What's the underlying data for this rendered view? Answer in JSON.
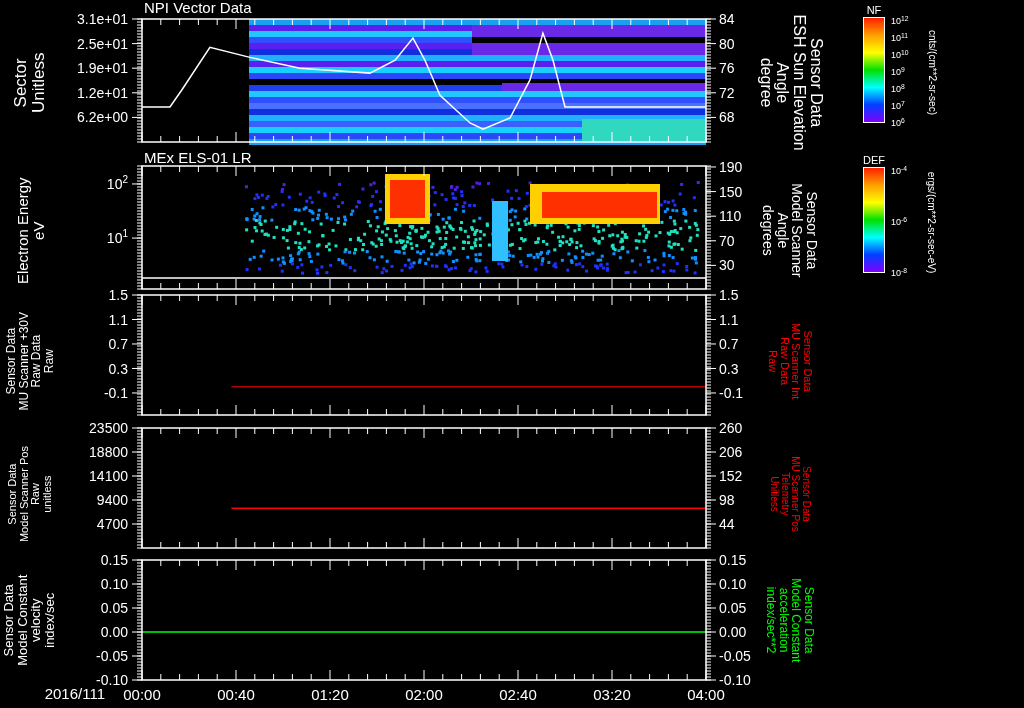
{
  "panels": [
    {
      "kind": "sectors",
      "title": "NPI Vector Data",
      "left_label": [
        "Sector",
        "Unitless"
      ],
      "left_ticks": [
        "3.1e+01",
        "2.5e+01",
        "1.9e+01",
        "1.2e+01",
        "6.2e+00"
      ],
      "chart_data": {
        "type": "line",
        "x": [
          0,
          11.9,
          17,
          28.9,
          45.5,
          67.2,
          97,
          107.7,
          115.3,
          120.4,
          126.8,
          139.6,
          145.1,
          156.6,
          165.1,
          170.6,
          174.9,
          180,
          240
        ],
        "series": [
          {
            "color": "#ffffff",
            "values": [
              69.7,
              69.7,
              72.5,
              79.4,
              77.8,
              76.0,
              75.2,
              77.3,
              80.9,
              77.3,
              71.6,
              67.1,
              66.1,
              67.9,
              74.1,
              81.7,
              77.3,
              69.7,
              69.7
            ]
          }
        ],
        "xlim": [
          0,
          240
        ],
        "ylim": [
          64,
          84
        ],
        "yticks": [
          {
            "value": 84,
            "label": "84"
          },
          {
            "value": 80,
            "label": "80"
          },
          {
            "value": 76,
            "label": "76"
          },
          {
            "value": 72,
            "label": "72"
          },
          {
            "value": 68,
            "label": "68"
          }
        ]
      },
      "right_label": {
        "lines": [
          "Sensor Data",
          "ESH Sun Elevation",
          "Angle",
          "degree"
        ],
        "color": "#ffffff"
      },
      "colorbar": {
        "name": "NF",
        "ticks": [
          "10$^{12}$",
          "10$^{11}$",
          "10$^{10}$",
          "10$^{9}$",
          "10$^{8}$",
          "10$^{7}$",
          "10$^{6}$"
        ],
        "units": "cnts/(cm**2-sr-sec)"
      }
    },
    {
      "kind": "energy",
      "title": "MEx ELS-01 LR",
      "left_label": [
        "Electron Energy",
        "eV"
      ],
      "left_ticks": [
        "10$^{2}$",
        "10$^{1}$"
      ],
      "right_ticks": [
        "190",
        "150",
        "110",
        "70",
        "30"
      ],
      "right_label": {
        "lines": [
          "Sensor Data",
          "Model Scanner",
          "Angle",
          "degrees"
        ],
        "color": "#ffffff"
      },
      "colorbar": {
        "name": "DEF",
        "ticks": [
          "10$^{-4}$",
          "10$^{-6}$",
          "10$^{-8}$"
        ],
        "units": "ergs/(cm**2-sr-sec-eV)"
      }
    },
    {
      "kind": "line",
      "left_label": [
        "Sensor Data",
        "MU Scanner +30V",
        "Raw Data",
        "Raw"
      ],
      "right_ticks": [
        "1.5",
        "1.1",
        "0.7",
        "0.3",
        "-0.1"
      ],
      "right_label": {
        "lines": [
          "Sensor Data",
          "MU Scanner Int",
          "Raw Data",
          "Raw"
        ],
        "color": "#ff0000"
      },
      "chart_data": {
        "type": "line",
        "x": [
          38,
          240
        ],
        "series": [
          {
            "color": "#b00000",
            "values": [
              0.0,
              0.0
            ]
          }
        ],
        "xlim": [
          0,
          240
        ],
        "ylim": [
          -0.46,
          1.5
        ],
        "yticks": [
          {
            "value": 1.5,
            "label": "1.5"
          },
          {
            "value": 1.1,
            "label": "1.1"
          },
          {
            "value": 0.7,
            "label": "0.7"
          },
          {
            "value": 0.3,
            "label": "0.3"
          },
          {
            "value": -0.1,
            "label": "-0.1"
          }
        ]
      }
    },
    {
      "kind": "line",
      "left_label": [
        "Sensor Data",
        "Model Scanner Pos",
        "Raw",
        "unitless"
      ],
      "right_ticks": [
        "260",
        "206",
        "152",
        "98",
        "44"
      ],
      "right_label": {
        "lines": [
          "Sensor Data",
          "MU Scanner Pos",
          "Telemetry",
          "Unitless"
        ],
        "color": "#ff0000"
      },
      "chart_data": {
        "type": "line",
        "x": [
          38,
          240
        ],
        "series": [
          {
            "color": "#ff0000",
            "values": [
              7800,
              7800
            ]
          }
        ],
        "xlim": [
          0,
          240
        ],
        "ylim": [
          0,
          23500
        ],
        "yticks": [
          {
            "value": 23500,
            "label": "23500"
          },
          {
            "value": 18800,
            "label": "18800"
          },
          {
            "value": 14100,
            "label": "14100"
          },
          {
            "value": 9400,
            "label": "9400"
          },
          {
            "value": 4700,
            "label": "4700"
          }
        ]
      }
    },
    {
      "kind": "line",
      "left_label": [
        "Sensor Data",
        "Model Constant",
        "velocity",
        "index/sec"
      ],
      "right_ticks": [
        "0.15",
        "0.10",
        "0.05",
        "0.00",
        "-0.05",
        "-0.10"
      ],
      "right_label": {
        "lines": [
          "Sensor Data",
          "Model Constant",
          "acceleration",
          "index/sec**2"
        ],
        "color": "#00ff00"
      },
      "chart_data": {
        "type": "line",
        "x": [
          0,
          240
        ],
        "series": [
          {
            "color": "#00ff00",
            "values": [
              0.0,
              0.0
            ]
          }
        ],
        "xlim": [
          0,
          240
        ],
        "ylim": [
          -0.1,
          0.15
        ],
        "xticks": [
          {
            "value": 0,
            "label": "00:00"
          },
          {
            "value": 40,
            "label": "00:40"
          },
          {
            "value": 80,
            "label": "01:20"
          },
          {
            "value": 120,
            "label": "02:00"
          },
          {
            "value": 160,
            "label": "02:40"
          },
          {
            "value": 200,
            "label": "03:20"
          },
          {
            "value": 240,
            "label": "04:00"
          }
        ],
        "yticks": [
          {
            "value": 0.15,
            "label": "0.15"
          },
          {
            "value": 0.1,
            "label": "0.10"
          },
          {
            "value": 0.05,
            "label": "0.05"
          },
          {
            "value": 0,
            "label": "0.00"
          },
          {
            "value": -0.05,
            "label": "-0.05"
          },
          {
            "value": -0.1,
            "label": "-0.10"
          }
        ]
      }
    }
  ],
  "time_axis": {
    "date": "2016/111"
  }
}
